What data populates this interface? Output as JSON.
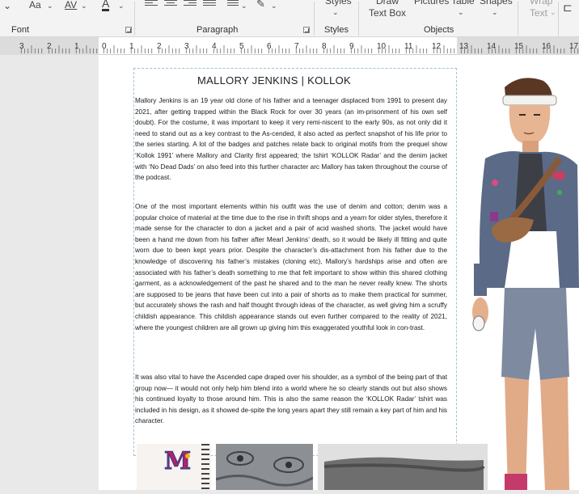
{
  "ribbon": {
    "font_group": {
      "label": "Font",
      "fontsize_button": "Aa",
      "spacing_button": "AV",
      "color_button": "A"
    },
    "paragraph_group": {
      "label": "Paragraph"
    },
    "styles_group": {
      "label": "Styles",
      "styles_button": "Styles"
    },
    "objects_group": {
      "label": "Objects",
      "draw_text_box": "Draw\nText Box",
      "pictures": "Pictures",
      "table": "Table",
      "shapes": "Shapes"
    },
    "wrap_text": "Wrap\nText"
  },
  "ruler": {
    "ticks": [
      "3",
      "2",
      "1",
      "0",
      "1",
      "2",
      "3",
      "4",
      "5",
      "6",
      "7",
      "8",
      "9",
      "10",
      "11",
      "12",
      "13",
      "14",
      "15",
      "16",
      "17"
    ]
  },
  "document": {
    "title": "MALLORY JENKINS | KOLLOK",
    "paragraphs": [
      "Mallory Jenkins is an 19 year old clone of his father and a teenager displaced from 1991 to present day 2021, after getting trapped within the Black Rock for over 30 years (an im-prisonment of his own self doubt). For the costume, it was important to keep it very remi-niscent to the early 90s, as not only did it need to stand out as a key contrast to the As-cended, it also acted as perfect snapshot of his life prior to the series starting. A lot of the badges and patches relate back to original motifs from the prequel show ‘Kollok 1991’ where Mallory and Clarity first appeared; the tshirt ‘KOLLOK Radar’ and the denim jacket with ‘No Dead Dads’ on also feed into this further character arc Mallory has taken throughout the course of the podcast.",
      "One of the most important elements within his outfit was the use of denim and cotton; denim was a popular choice of material at the time due to the rise in thrift shops and a yearn for older styles, therefore it made sense for the character to don a jacket and a pair of acid washed shorts. The jacket would have been a hand me down from his father after Mearl Jenkins’ death, so it would be likely ill fitting and quite worn due to been kept years prior. Despite the character’s dis-attachment from his father due to the knowledge of discovering his father’s mistakes (cloning etc), Mallory’s hardships arise and often are associated with his father’s death something to me that felt important to show within this shared clothing garment, as a acknowledgement of the past he shared and to the man he never really knew. The shorts are supposed to be jeans that have been cut into a pair of shorts as to make them practical for summer, but accurately shows the rash and half thought through ideas of the character, as well giving him a scruffy childish appearance. This childish appearance stands out even further compared to the reality of 2021, where the youngest children are all grown up giving him this exaggerated youthful look in con-trast.",
      "It was also vital to have the Ascended cape draped over his shoulder, as a symbol of the being part of that group now— it would not only help him blend into a world where he so clearly stands out but also shows his continued loyalty to those around him. This is also the same reason the ‘KOLLOK Radar’ tshirt was included in his design, as it showed de-spite the long years apart they still remain a key part of him and his character."
    ]
  },
  "thumbs": {
    "badge_letter": "M"
  },
  "colors": {
    "ribbon_bg": "#f3f3f3",
    "page_bg": "#ffffff",
    "workspace_bg": "#e9e9e9",
    "frame_guide": "#9fc3d6"
  }
}
